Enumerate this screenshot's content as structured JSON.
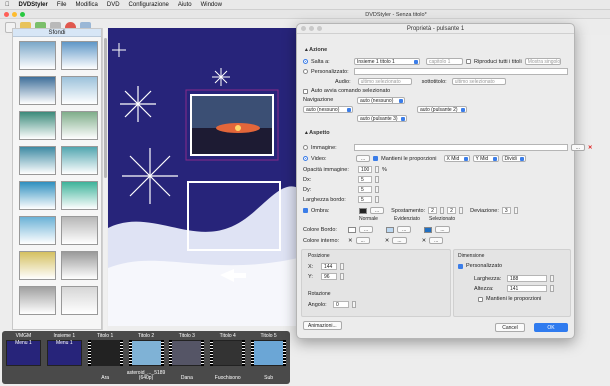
{
  "menubar": {
    "apple": "",
    "app": "DVDStyler",
    "items": [
      "File",
      "Modifica",
      "DVD",
      "Configurazione",
      "Aiuto",
      "Window"
    ]
  },
  "sidebar": {
    "header": "Sfondi"
  },
  "thumbs": [
    "#7aa7c8",
    "#5f97c7",
    "#3f6f9a",
    "#9cc2db",
    "#3b8a7a",
    "#7fae8a",
    "#3e8aa3",
    "#52a6b0",
    "#2e8fbf",
    "#3db39a",
    "#6bb2d6",
    "#b7b7b7",
    "#d4c060",
    "#9a9a9a",
    "#a0a0a0",
    "#d6d6d6"
  ],
  "strip": [
    {
      "label": "VMGM",
      "sub": "Menu 1",
      "caption": "",
      "color": "#27247a"
    },
    {
      "label": "Insieme 1",
      "sub": "Menu 1",
      "caption": "",
      "color": "#27247a"
    },
    {
      "label": "Titolo 1",
      "sub": "",
      "caption": "Ara",
      "color": "#222"
    },
    {
      "label": "Titolo 2",
      "sub": "",
      "caption": "asteroid_..._5189 (640p)",
      "color": "#7fb2d6"
    },
    {
      "label": "Titolo 3",
      "sub": "",
      "caption": "Dana",
      "color": "#556"
    },
    {
      "label": "Titolo 4",
      "sub": "",
      "caption": "Fuochisono",
      "color": "#333"
    },
    {
      "label": "Titolo 5",
      "sub": "",
      "caption": "Sub",
      "color": "#6ba6d6"
    }
  ],
  "main_title": "DVDStyler - Senza titolo*",
  "dialog": {
    "title": "Proprietà - pulsante 1",
    "azione": "Azione",
    "salta_a": "Salta a:",
    "salta_sel": "Insieme 1 titolo 1",
    "capitolo": "capitolo 1",
    "riproduci": "Riproduci tutti i titoli",
    "mostra": "Mostra singolo",
    "personalizzato": "Personalizzato:",
    "audio": "Audio:",
    "ultimo1": "ultimo selezionato",
    "sottotitolo": "sottotitolo:",
    "ultimo2": "ultimo selezionato",
    "auto": "Auto avvia comando selezionato",
    "navigazione": "Navigazione",
    "nav_up": "auto (nessuno)",
    "nav_left": "auto (nessuno)",
    "nav_right": "auto (pulsante 2)",
    "nav_down": "auto (pulsante 3)",
    "aspetto": "Aspetto",
    "immagine": "Immagine:",
    "video": "Video:",
    "mantieni": "Mantieni le proporzioni",
    "xmid": "X Mid",
    "ymid": "Y Mid",
    "divid": "Dividi",
    "opacita": "Opacità immagine:",
    "opacita_val": "100",
    "pct": "%",
    "dx": "Dx:",
    "dx_val": "5",
    "dy": "Dy:",
    "dy_val": "5",
    "largh": "Larghezza bordo:",
    "largh_val": "5",
    "ombra": "Ombra:",
    "spost": "Spostamento:",
    "spost1": "2",
    "spost2": "2",
    "deviaz": "Deviazione:",
    "deviaz_val": "3",
    "normale": "Normale",
    "evidenziato": "Evidenziato",
    "selezionato": "Selezionato",
    "colore_bordo": "Colore Bordo:",
    "colore_interno": "Colore interno:",
    "posizione": "Posizione",
    "x": "X:",
    "x_val": "144",
    "y": "Y:",
    "y_val": "96",
    "rotazione": "Rotazione",
    "angolo": "Angolo:",
    "angolo_val": "0",
    "dimensione": "Dimensione",
    "personalizzato2": "Personalizzato",
    "larghezza": "Larghezza:",
    "larghezza_val": "188",
    "altezza": "Altezza:",
    "altezza_val": "141",
    "mantieni2": "Mantieni le proporzioni",
    "animazioni": "Animazioni...",
    "cancel": "Cancel",
    "ok": "OK",
    "dots": "..."
  }
}
